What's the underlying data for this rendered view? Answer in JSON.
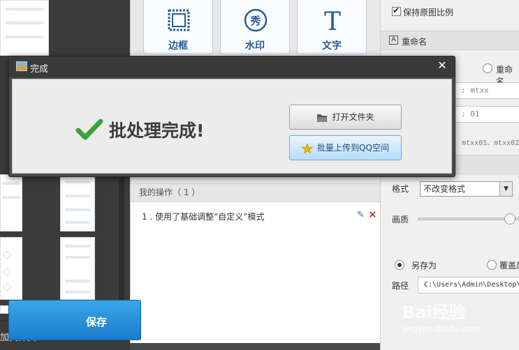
{
  "left_panel": {
    "add_folder_label": "加文件夹",
    "actions": [
      {
        "name": "delete",
        "glyph": "✕"
      },
      {
        "name": "undo",
        "glyph": "↶"
      },
      {
        "name": "redo",
        "glyph": "↷"
      }
    ]
  },
  "toolbar": {
    "tools": [
      {
        "label": "边框",
        "icon": "border-frame-icon"
      },
      {
        "label": "水印",
        "icon": "watermark-stamp-icon",
        "glyph": "秀"
      },
      {
        "label": "文字",
        "icon": "text-T-icon",
        "glyph": "T"
      }
    ]
  },
  "operations": {
    "header": "我的操作（ 1 ）",
    "items": [
      {
        "text": "1 . 使用了基础调整“自定义”模式"
      }
    ]
  },
  "right_panel": {
    "keep_ratio_label": "保持原图比例",
    "keep_ratio_checked": true,
    "rename_label": "重命名",
    "rename_option_label": "重命名",
    "prefix_field": ": mtxx",
    "start_field": ": 01",
    "example_text": "mtxx01、mtxx02",
    "format_label": "格式",
    "format_value": "不改变格式",
    "quality_label": "画质",
    "quality_level": 0.95,
    "save_as_label": "另存为",
    "overwrite_label": "覆盖原",
    "save_mode": "save_as",
    "path_label": "路径",
    "path_value": "C:\\Users\\Admin\\Desktop\\",
    "save_button_label": "保存"
  },
  "dialog": {
    "title": "完成",
    "close_glyph": "✕",
    "message": "批处理完成!",
    "open_folder_label": "打开文件夹",
    "upload_label": "批量上传到QQ空间"
  },
  "watermark": {
    "brand": "Bai经验",
    "url": "jingyan.baidu.com"
  },
  "colors": {
    "accent_blue": "#2a5b98",
    "save_button": "#1a7ccd",
    "success_green": "#3aa33a",
    "delete_red": "#cc1d1d"
  }
}
